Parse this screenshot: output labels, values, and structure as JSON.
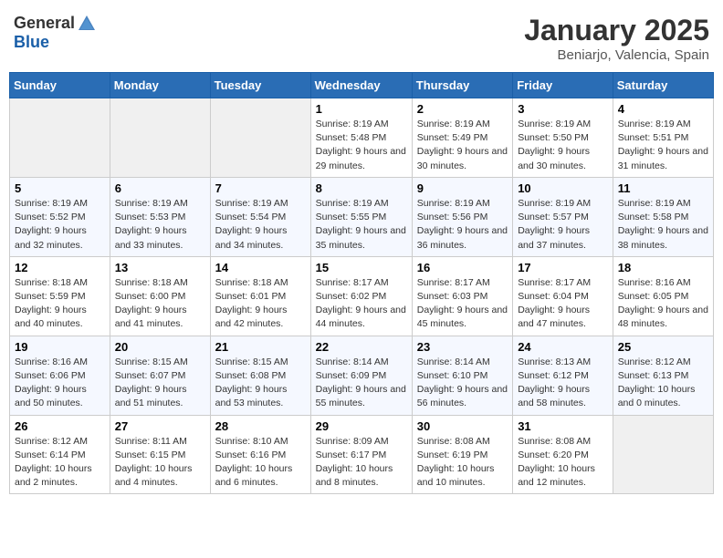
{
  "header": {
    "logo_general": "General",
    "logo_blue": "Blue",
    "title": "January 2025",
    "subtitle": "Beniarjo, Valencia, Spain"
  },
  "days_of_week": [
    "Sunday",
    "Monday",
    "Tuesday",
    "Wednesday",
    "Thursday",
    "Friday",
    "Saturday"
  ],
  "weeks": [
    [
      {
        "day": "",
        "empty": true
      },
      {
        "day": "",
        "empty": true
      },
      {
        "day": "",
        "empty": true
      },
      {
        "day": "1",
        "sunrise": "Sunrise: 8:19 AM",
        "sunset": "Sunset: 5:48 PM",
        "daylight": "Daylight: 9 hours and 29 minutes."
      },
      {
        "day": "2",
        "sunrise": "Sunrise: 8:19 AM",
        "sunset": "Sunset: 5:49 PM",
        "daylight": "Daylight: 9 hours and 30 minutes."
      },
      {
        "day": "3",
        "sunrise": "Sunrise: 8:19 AM",
        "sunset": "Sunset: 5:50 PM",
        "daylight": "Daylight: 9 hours and 30 minutes."
      },
      {
        "day": "4",
        "sunrise": "Sunrise: 8:19 AM",
        "sunset": "Sunset: 5:51 PM",
        "daylight": "Daylight: 9 hours and 31 minutes."
      }
    ],
    [
      {
        "day": "5",
        "sunrise": "Sunrise: 8:19 AM",
        "sunset": "Sunset: 5:52 PM",
        "daylight": "Daylight: 9 hours and 32 minutes."
      },
      {
        "day": "6",
        "sunrise": "Sunrise: 8:19 AM",
        "sunset": "Sunset: 5:53 PM",
        "daylight": "Daylight: 9 hours and 33 minutes."
      },
      {
        "day": "7",
        "sunrise": "Sunrise: 8:19 AM",
        "sunset": "Sunset: 5:54 PM",
        "daylight": "Daylight: 9 hours and 34 minutes."
      },
      {
        "day": "8",
        "sunrise": "Sunrise: 8:19 AM",
        "sunset": "Sunset: 5:55 PM",
        "daylight": "Daylight: 9 hours and 35 minutes."
      },
      {
        "day": "9",
        "sunrise": "Sunrise: 8:19 AM",
        "sunset": "Sunset: 5:56 PM",
        "daylight": "Daylight: 9 hours and 36 minutes."
      },
      {
        "day": "10",
        "sunrise": "Sunrise: 8:19 AM",
        "sunset": "Sunset: 5:57 PM",
        "daylight": "Daylight: 9 hours and 37 minutes."
      },
      {
        "day": "11",
        "sunrise": "Sunrise: 8:19 AM",
        "sunset": "Sunset: 5:58 PM",
        "daylight": "Daylight: 9 hours and 38 minutes."
      }
    ],
    [
      {
        "day": "12",
        "sunrise": "Sunrise: 8:18 AM",
        "sunset": "Sunset: 5:59 PM",
        "daylight": "Daylight: 9 hours and 40 minutes."
      },
      {
        "day": "13",
        "sunrise": "Sunrise: 8:18 AM",
        "sunset": "Sunset: 6:00 PM",
        "daylight": "Daylight: 9 hours and 41 minutes."
      },
      {
        "day": "14",
        "sunrise": "Sunrise: 8:18 AM",
        "sunset": "Sunset: 6:01 PM",
        "daylight": "Daylight: 9 hours and 42 minutes."
      },
      {
        "day": "15",
        "sunrise": "Sunrise: 8:17 AM",
        "sunset": "Sunset: 6:02 PM",
        "daylight": "Daylight: 9 hours and 44 minutes."
      },
      {
        "day": "16",
        "sunrise": "Sunrise: 8:17 AM",
        "sunset": "Sunset: 6:03 PM",
        "daylight": "Daylight: 9 hours and 45 minutes."
      },
      {
        "day": "17",
        "sunrise": "Sunrise: 8:17 AM",
        "sunset": "Sunset: 6:04 PM",
        "daylight": "Daylight: 9 hours and 47 minutes."
      },
      {
        "day": "18",
        "sunrise": "Sunrise: 8:16 AM",
        "sunset": "Sunset: 6:05 PM",
        "daylight": "Daylight: 9 hours and 48 minutes."
      }
    ],
    [
      {
        "day": "19",
        "sunrise": "Sunrise: 8:16 AM",
        "sunset": "Sunset: 6:06 PM",
        "daylight": "Daylight: 9 hours and 50 minutes."
      },
      {
        "day": "20",
        "sunrise": "Sunrise: 8:15 AM",
        "sunset": "Sunset: 6:07 PM",
        "daylight": "Daylight: 9 hours and 51 minutes."
      },
      {
        "day": "21",
        "sunrise": "Sunrise: 8:15 AM",
        "sunset": "Sunset: 6:08 PM",
        "daylight": "Daylight: 9 hours and 53 minutes."
      },
      {
        "day": "22",
        "sunrise": "Sunrise: 8:14 AM",
        "sunset": "Sunset: 6:09 PM",
        "daylight": "Daylight: 9 hours and 55 minutes."
      },
      {
        "day": "23",
        "sunrise": "Sunrise: 8:14 AM",
        "sunset": "Sunset: 6:10 PM",
        "daylight": "Daylight: 9 hours and 56 minutes."
      },
      {
        "day": "24",
        "sunrise": "Sunrise: 8:13 AM",
        "sunset": "Sunset: 6:12 PM",
        "daylight": "Daylight: 9 hours and 58 minutes."
      },
      {
        "day": "25",
        "sunrise": "Sunrise: 8:12 AM",
        "sunset": "Sunset: 6:13 PM",
        "daylight": "Daylight: 10 hours and 0 minutes."
      }
    ],
    [
      {
        "day": "26",
        "sunrise": "Sunrise: 8:12 AM",
        "sunset": "Sunset: 6:14 PM",
        "daylight": "Daylight: 10 hours and 2 minutes."
      },
      {
        "day": "27",
        "sunrise": "Sunrise: 8:11 AM",
        "sunset": "Sunset: 6:15 PM",
        "daylight": "Daylight: 10 hours and 4 minutes."
      },
      {
        "day": "28",
        "sunrise": "Sunrise: 8:10 AM",
        "sunset": "Sunset: 6:16 PM",
        "daylight": "Daylight: 10 hours and 6 minutes."
      },
      {
        "day": "29",
        "sunrise": "Sunrise: 8:09 AM",
        "sunset": "Sunset: 6:17 PM",
        "daylight": "Daylight: 10 hours and 8 minutes."
      },
      {
        "day": "30",
        "sunrise": "Sunrise: 8:08 AM",
        "sunset": "Sunset: 6:19 PM",
        "daylight": "Daylight: 10 hours and 10 minutes."
      },
      {
        "day": "31",
        "sunrise": "Sunrise: 8:08 AM",
        "sunset": "Sunset: 6:20 PM",
        "daylight": "Daylight: 10 hours and 12 minutes."
      },
      {
        "day": "",
        "empty": true
      }
    ]
  ]
}
